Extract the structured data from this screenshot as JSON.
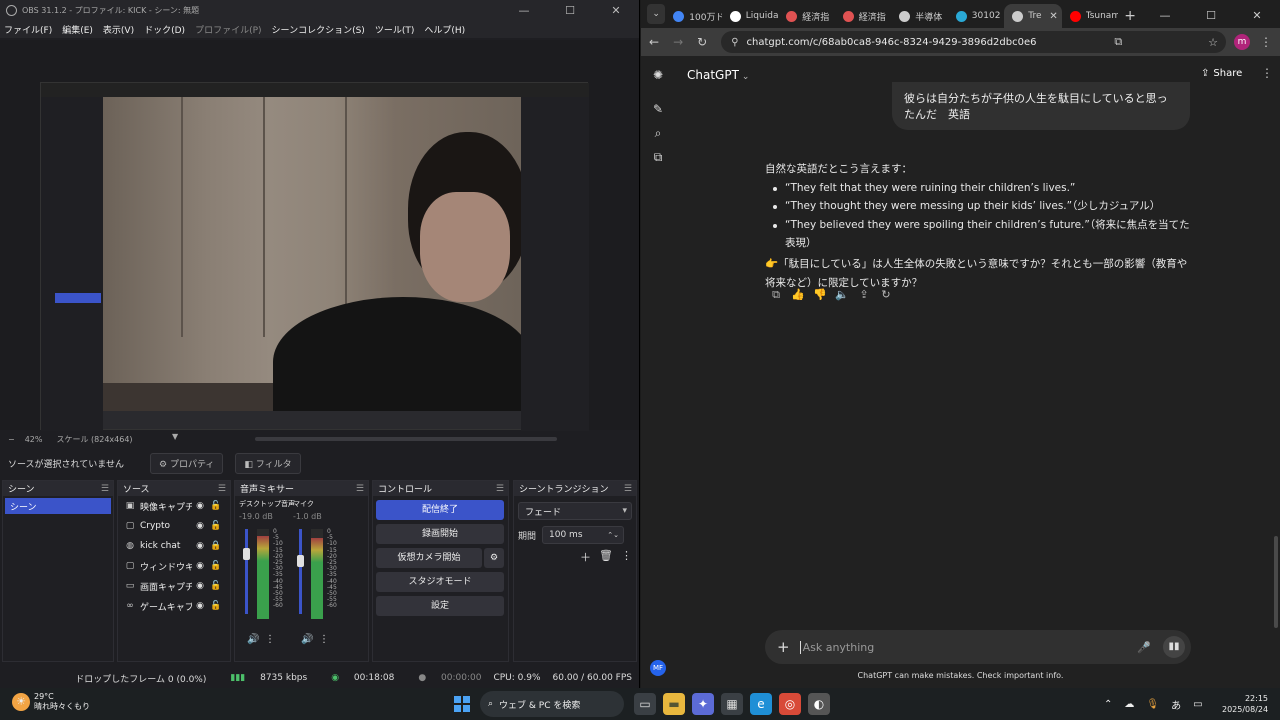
{
  "obs": {
    "title": "OBS 31.1.2 - プロファイル: KICK - シーン: 無題",
    "window_controls": [
      "—",
      "☐",
      "✕"
    ],
    "menu": [
      "ファイル(F)",
      "編集(E)",
      "表示(V)",
      "ドック(D)",
      "プロファイル(P)",
      "シーンコレクション(S)",
      "ツール(T)",
      "ヘルプ(H)"
    ],
    "zoom": "42%",
    "scale": "スケール (824x464)",
    "no_source": "ソースが選択されていません",
    "properties_btn": "プロパティ",
    "filters_btn": "フィルタ",
    "docks": {
      "scenes": "シーン",
      "sources": "ソース",
      "mixer": "音声ミキサー",
      "controls": "コントロール",
      "transitions": "シーントランジション"
    },
    "scene_items": [
      "シーン"
    ],
    "sources": [
      {
        "icon": "▣",
        "name": "映像キャプチャ"
      },
      {
        "icon": "▢",
        "name": "Crypto"
      },
      {
        "icon": "◍",
        "name": "kick chat"
      },
      {
        "icon": "▢",
        "name": "ウィンドウキャプ"
      },
      {
        "icon": "▭",
        "name": "画面キャプチャ"
      },
      {
        "icon": "∞",
        "name": "ゲームキャプチャ"
      }
    ],
    "mixer": {
      "desktop": {
        "name": "デスクトップ音声",
        "db": "-19.0 dB",
        "level": 0.78
      },
      "mic": {
        "name": "マイク",
        "db": "-1.0 dB",
        "level": 0.7
      },
      "scale": [
        "0",
        "-5",
        "-10",
        "-15",
        "-20",
        "-25",
        "-30",
        "-35",
        "-40",
        "-45",
        "-50",
        "-55",
        "-60"
      ]
    },
    "controls": {
      "stop_stream": "配信終了",
      "start_recording": "録画開始",
      "virtual_camera": "仮想カメラ開始",
      "studio_mode": "スタジオモード",
      "settings": "設定"
    },
    "transition": {
      "type": "フェード",
      "duration_label": "期間",
      "duration": "100 ms"
    },
    "status": {
      "dropped": "ドロップしたフレーム 0 (0.0%)",
      "bitrate": "8735 kbps",
      "stream_time": "00:18:08",
      "rec_time": "00:00:00",
      "cpu": "CPU: 0.9%",
      "fps": "60.00 / 60.00 FPS"
    }
  },
  "chrome": {
    "tabs": [
      {
        "title": "100万ド",
        "color": "#4285f4"
      },
      {
        "title": "Liquida",
        "color": "#ffffff"
      },
      {
        "title": "経済指",
        "color": "#e05252"
      },
      {
        "title": "経済指",
        "color": "#e05252"
      },
      {
        "title": "半導体",
        "color": "#cccccc"
      },
      {
        "title": "30102",
        "color": "#2aa9d6"
      },
      {
        "title": "Tre",
        "color": "#cccccc"
      },
      {
        "title": "Tsunam",
        "color": "#ff0000"
      }
    ],
    "url": "chatgpt.com/c/68ab0ca8-946c-8324-9429-3896d2dbc0e6",
    "profile_initial": "m"
  },
  "chatgpt": {
    "model": "ChatGPT",
    "share": "Share",
    "user_message": "彼らは自分たちが子供の人生を駄目にしていると思ったんだ　英語",
    "intro": "自然な英語だとこう言えます：",
    "bullets": [
      "“They felt that they were ruining their children’s lives.”",
      "“They thought they were messing up their kids’ lives.”（少しカジュアル）",
      "“They believed they were spoiling their children’s future.”（将来に焦点を当てた表現）"
    ],
    "followup": "👉「駄目にしている」は人生全体の失敗という意味ですか？それとも一部の影響（教育や将来など）に限定していますか？",
    "placeholder": "Ask anything",
    "disclaimer": "ChatGPT can make mistakes. Check important info.",
    "avatar": "MF"
  },
  "taskbar": {
    "temp": "29°C",
    "weather": "晴れ時々くもり",
    "search": "ウェブ & PC を検索",
    "time": "22:15",
    "date": "2025/08/24",
    "ime": "あ"
  }
}
